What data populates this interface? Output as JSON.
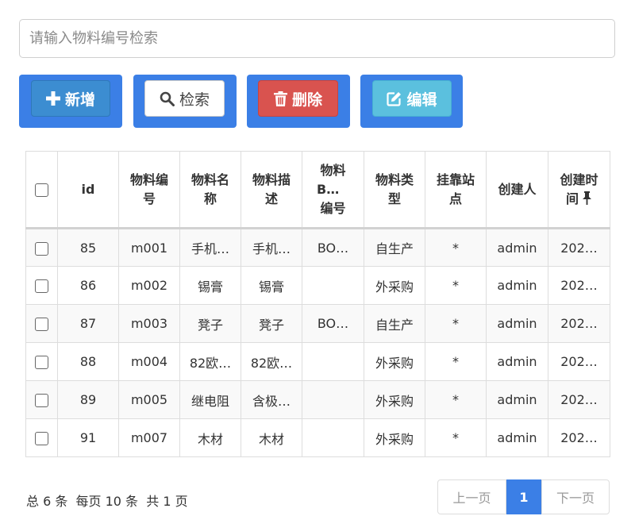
{
  "search": {
    "placeholder": "请输入物料编号检索",
    "value": ""
  },
  "toolbar": {
    "add_label": "新增",
    "search_label": "检索",
    "delete_label": "删除",
    "edit_label": "编辑",
    "icons": [
      "plus-icon",
      "search-icon",
      "trash-icon",
      "edit-icon"
    ],
    "colors": {
      "frame": "#3b7fe6",
      "add": "#3c8dd1",
      "delete": "#d9534f",
      "edit": "#5bc0de"
    }
  },
  "table": {
    "columns": [
      "id",
      "物料编号",
      "物料名称",
      "物料描述",
      "物料BOM编号",
      "物料类型",
      "挂靠站点",
      "创建人",
      "创建时间"
    ],
    "rows": [
      [
        "85",
        "m001",
        "手机…",
        "手机…",
        "BO…",
        "自生产",
        "*",
        "admin",
        "202…"
      ],
      [
        "86",
        "m002",
        "锡膏",
        "锡膏",
        "",
        "外采购",
        "*",
        "admin",
        "202…"
      ],
      [
        "87",
        "m003",
        "凳子",
        "凳子",
        "BO…",
        "自生产",
        "*",
        "admin",
        "202…"
      ],
      [
        "88",
        "m004",
        "82欧…",
        "82欧…",
        "",
        "外采购",
        "*",
        "admin",
        "202…"
      ],
      [
        "89",
        "m005",
        "继电阻",
        "含极…",
        "",
        "外采购",
        "*",
        "admin",
        "202…"
      ],
      [
        "91",
        "m007",
        "木材",
        "木材",
        "",
        "外采购",
        "*",
        "admin",
        "202…"
      ]
    ]
  },
  "pagination": {
    "summary": "总 6 条  每页 10 条  共 1 页",
    "prev_label": "上一页",
    "current_page": "1",
    "next_label": "下一页"
  }
}
